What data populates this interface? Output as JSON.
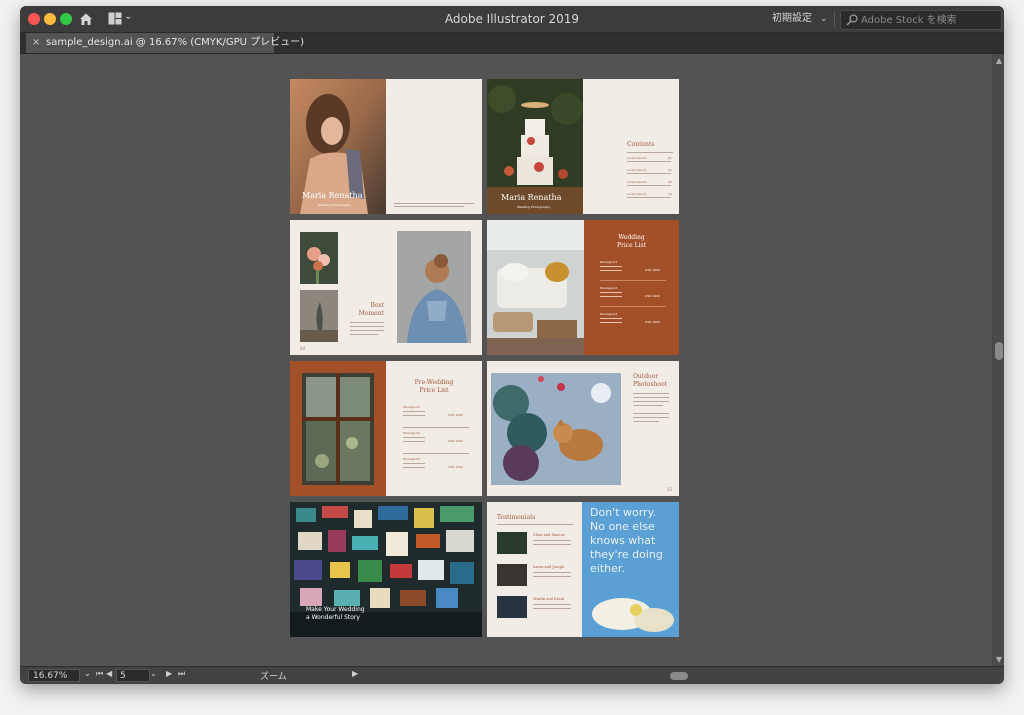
{
  "app": {
    "title": "Adobe Illustrator 2019",
    "workspace_preset": "初期設定",
    "stock_search_placeholder": "Adobe Stock を検索"
  },
  "document_tab": {
    "label": "sample_design.ai @ 16.67% (CMYK/GPU プレビュー)",
    "close_glyph": "×"
  },
  "artboards": {
    "a1": {
      "name": "Maria Renatha",
      "subtitle": "Wedding Photography"
    },
    "a2": {
      "name": "Maria Renatha",
      "subtitle": "Wedding Photography",
      "heading": "Contents",
      "items": [
        "Lorem Ipsum",
        "Lorem Ipsum",
        "Lorem Ipsum",
        "Lorem Ipsum"
      ],
      "numbers": [
        "01",
        "02",
        "03",
        "04"
      ]
    },
    "a3": {
      "heading_line1": "Best",
      "heading_line2": "Moment",
      "page": "04"
    },
    "a4": {
      "heading_line1": "Wedding",
      "heading_line2": "Price List",
      "packages": [
        "Package 01",
        "Package 02",
        "Package 03"
      ],
      "price": "USD 1000"
    },
    "a5": {
      "heading_line1": "Pre-Wedding",
      "heading_line2": "Price List",
      "packages": [
        "Package 01",
        "Package 02",
        "Package 03"
      ],
      "price": "USD 1000"
    },
    "a6": {
      "heading_line1": "Outdoor",
      "heading_line2": "Photoshoot",
      "page": "12"
    },
    "a7": {
      "line1": "Make Your Wedding",
      "line2": "a Wonderful Story"
    },
    "a8": {
      "heading": "Testimonials",
      "people": [
        "Clara and Marcus",
        "Laura and Joseph",
        "Martin and David"
      ],
      "quote_lines": [
        "Don't worry.",
        "No one else",
        "knows what",
        "they're doing",
        "either."
      ]
    }
  },
  "statusbar": {
    "zoom": "16.67%",
    "page": "5",
    "label": "ズーム"
  }
}
